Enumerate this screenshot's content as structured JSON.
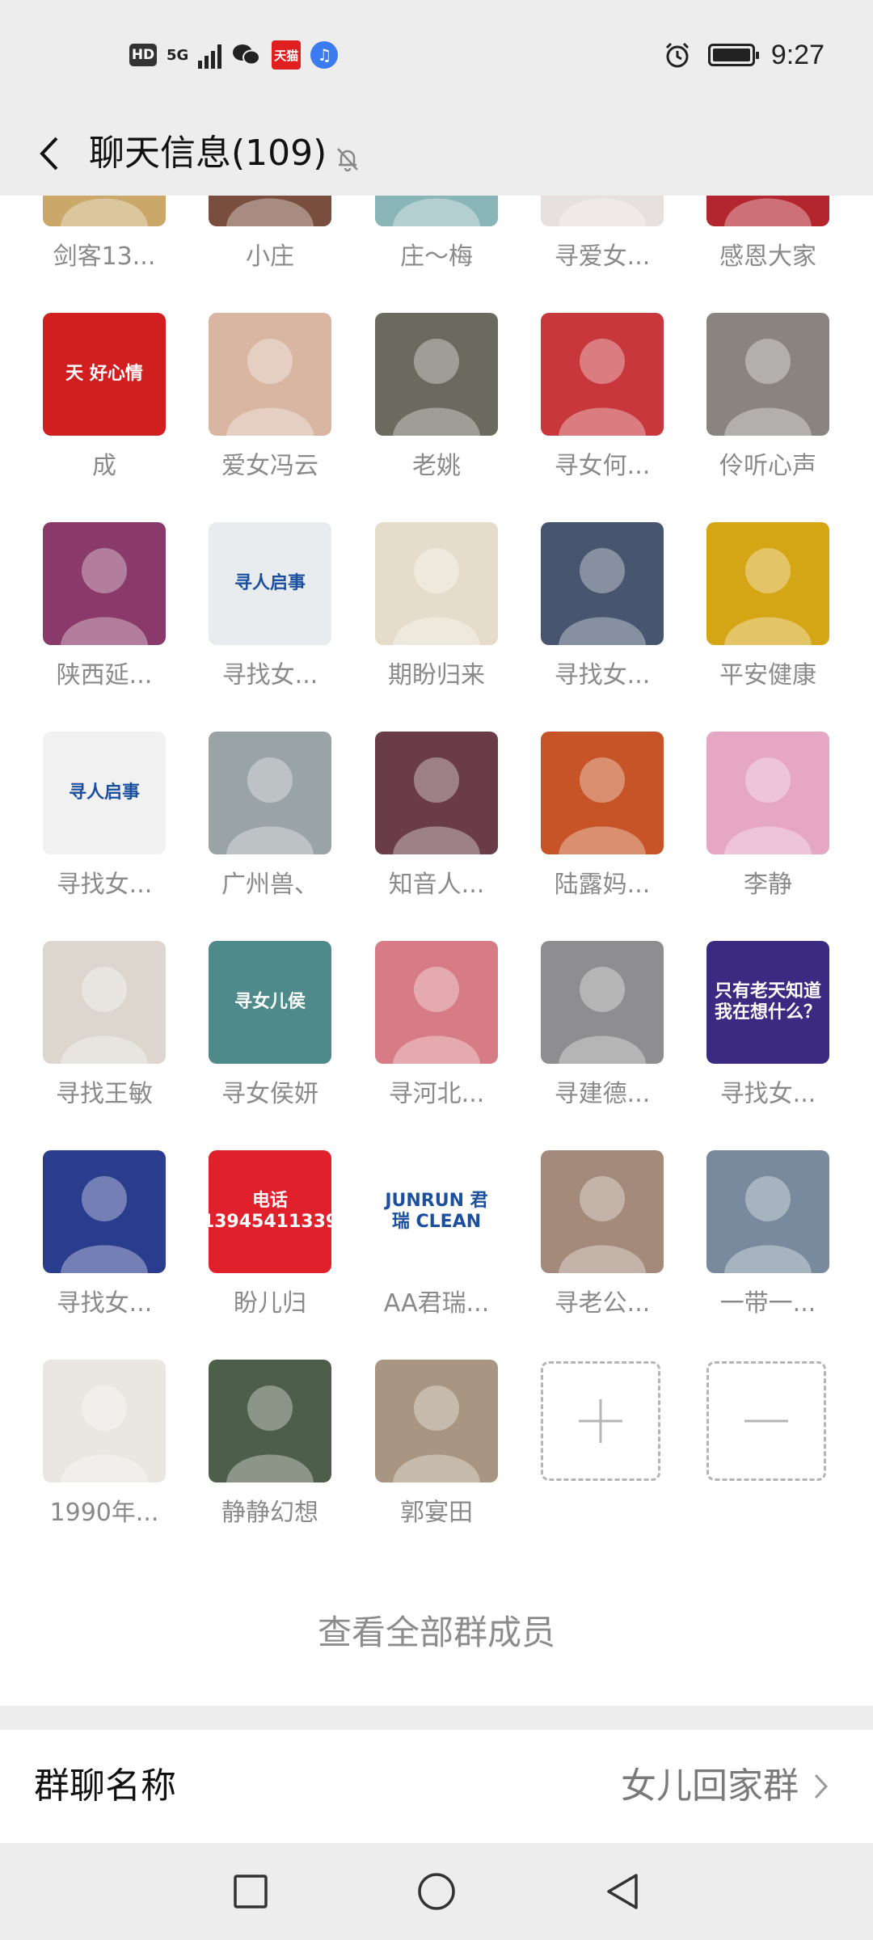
{
  "status_bar": {
    "hd": "HD",
    "network": "5G",
    "tmall": "天猫",
    "time": "9:27"
  },
  "header": {
    "title": "聊天信息(109)"
  },
  "members": [
    {
      "name": "剑客13...",
      "bg": "#c9a86a"
    },
    {
      "name": "小庄",
      "bg": "#7a4e3e"
    },
    {
      "name": "庄～梅",
      "bg": "#8ab6b8"
    },
    {
      "name": "寻爱女...",
      "bg": "#e8e0de"
    },
    {
      "name": "感恩大家",
      "bg": "#b3262d"
    },
    {
      "name": "成",
      "bg": "#d11f1f",
      "text": "天 好心情"
    },
    {
      "name": "爱女冯云",
      "bg": "#d8b6a2"
    },
    {
      "name": "老姚",
      "bg": "#6b6a5e"
    },
    {
      "name": "寻女何...",
      "bg": "#c8373c"
    },
    {
      "name": "伶听心声",
      "bg": "#8a8480"
    },
    {
      "name": "陕西延...",
      "bg": "#8a3a6a"
    },
    {
      "name": "寻找女...",
      "bg": "#e9ecef",
      "text": "寻人启事"
    },
    {
      "name": "期盼归来",
      "bg": "#e6dccb"
    },
    {
      "name": "寻找女...",
      "bg": "#48556e"
    },
    {
      "name": "平安健康",
      "bg": "#d4a514"
    },
    {
      "name": "寻找女...",
      "bg": "#f1f1f1",
      "text": "寻人启事"
    },
    {
      "name": "广州兽、",
      "bg": "#9aa4a6"
    },
    {
      "name": "知音人...",
      "bg": "#6a3c4a"
    },
    {
      "name": "陆露妈...",
      "bg": "#c65426"
    },
    {
      "name": "李静",
      "bg": "#e5a7c3"
    },
    {
      "name": "寻找王敏",
      "bg": "#dcd6cf"
    },
    {
      "name": "寻女侯妍",
      "bg": "#4e8a8a",
      "text": "寻女儿侯"
    },
    {
      "name": "寻河北...",
      "bg": "#d77c86"
    },
    {
      "name": "寻建德...",
      "bg": "#8e8e90"
    },
    {
      "name": "寻找女...",
      "bg": "#3a2a82",
      "text": "只有老天知道 我在想什么？"
    },
    {
      "name": "寻找女...",
      "bg": "#2a3c8e"
    },
    {
      "name": "盼儿归",
      "bg": "#e0202a",
      "text": "电话 13945411339"
    },
    {
      "name": "AA君瑞...",
      "bg": "#ffffff",
      "text": "JUNRUN 君瑞 CLEAN"
    },
    {
      "name": "寻老公...",
      "bg": "#a48a7a"
    },
    {
      "name": "一带一...",
      "bg": "#7a8a9e"
    },
    {
      "name": "1990年...",
      "bg": "#eae6e2"
    },
    {
      "name": "静静幻想",
      "bg": "#4d5e4a"
    },
    {
      "name": "郭宴田",
      "bg": "#a89682"
    }
  ],
  "view_all": "查看全部群成员",
  "group_name_row": {
    "label": "群聊名称",
    "value": "女儿回家群"
  }
}
